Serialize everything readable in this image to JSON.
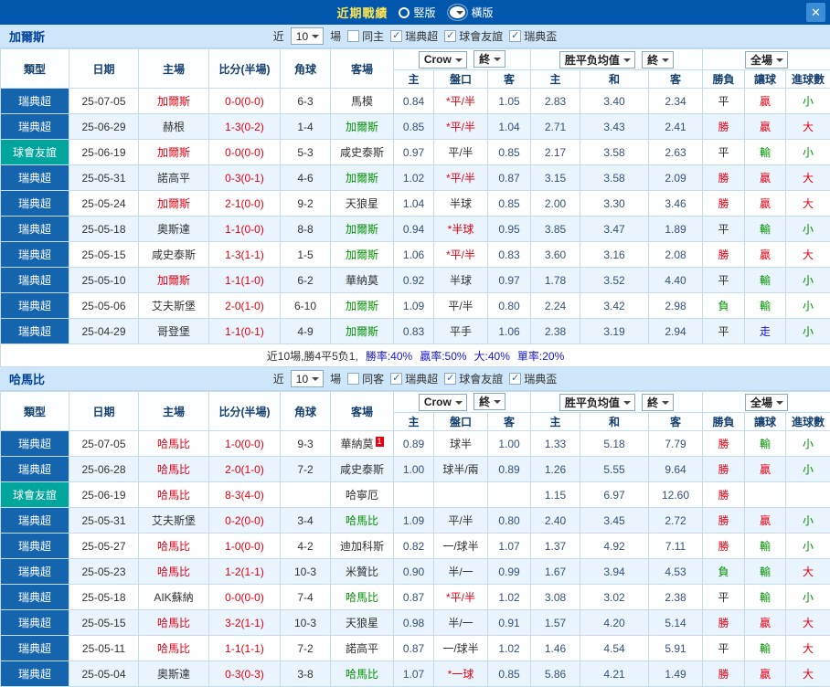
{
  "titlebar": {
    "title": "近期戰績",
    "vertical": "竪版",
    "horizontal": "橫版",
    "close": "✕"
  },
  "labels": {
    "near": "近",
    "count": "10",
    "matches": "場",
    "company": "Crow",
    "final": "終",
    "avg": "胜平负均值",
    "full": "全場",
    "filters": [
      "瑞典超",
      "球會友誼",
      "瑞典盃"
    ]
  },
  "columns": {
    "type": "類型",
    "date": "日期",
    "home": "主場",
    "score": "比分(半場)",
    "corner": "角球",
    "away": "客場",
    "h": "主",
    "handicap": "盤口",
    "a": "客",
    "avg_h": "主",
    "avg_d": "和",
    "avg_a": "客",
    "result": "勝負",
    "hresult": "讓球",
    "goals": "進球數"
  },
  "sections": [
    {
      "team": "加爾斯",
      "same_label": "同主",
      "rows": [
        {
          "league": "瑞典超",
          "lc": "lg-super",
          "date": "25-07-05",
          "home": "加爾斯",
          "home_c": "red",
          "score": "0-0(0-0)",
          "corner": "6-3",
          "away": "馬模",
          "away_c": "dark",
          "oh": "0.84",
          "hcap": "*平/半",
          "hcap_c": "red",
          "oa": "1.05",
          "ah": "2.83",
          "ad": "3.40",
          "aa": "2.34",
          "res": "平",
          "res_c": "dark",
          "hr": "贏",
          "hr_c": "red",
          "g": "小",
          "g_c": "green"
        },
        {
          "league": "瑞典超",
          "lc": "lg-super",
          "date": "25-06-29",
          "home": "赫根",
          "home_c": "dark",
          "score": "1-3(0-2)",
          "corner": "1-4",
          "away": "加爾斯",
          "away_c": "green",
          "oh": "0.85",
          "hcap": "*平/半",
          "hcap_c": "red",
          "oa": "1.04",
          "ah": "2.71",
          "ad": "3.43",
          "aa": "2.41",
          "res": "勝",
          "res_c": "red",
          "hr": "贏",
          "hr_c": "red",
          "g": "大",
          "g_c": "red"
        },
        {
          "league": "球會友誼",
          "lc": "lg-friendly",
          "date": "25-06-19",
          "home": "加爾斯",
          "home_c": "red",
          "score": "0-0(0-0)",
          "corner": "5-3",
          "away": "咸史泰斯",
          "away_c": "dark",
          "oh": "0.97",
          "hcap": "平/半",
          "hcap_c": "dark",
          "oa": "0.85",
          "ah": "2.17",
          "ad": "3.58",
          "aa": "2.63",
          "res": "平",
          "res_c": "dark",
          "hr": "輸",
          "hr_c": "green",
          "g": "小",
          "g_c": "green"
        },
        {
          "league": "瑞典超",
          "lc": "lg-super",
          "date": "25-05-31",
          "home": "諾高平",
          "home_c": "dark",
          "score": "0-3(0-1)",
          "corner": "4-6",
          "away": "加爾斯",
          "away_c": "green",
          "oh": "1.02",
          "hcap": "*平/半",
          "hcap_c": "red",
          "oa": "0.87",
          "ah": "3.15",
          "ad": "3.58",
          "aa": "2.09",
          "res": "勝",
          "res_c": "red",
          "hr": "贏",
          "hr_c": "red",
          "g": "大",
          "g_c": "red"
        },
        {
          "league": "瑞典超",
          "lc": "lg-super",
          "date": "25-05-24",
          "home": "加爾斯",
          "home_c": "red",
          "score": "2-1(0-0)",
          "corner": "9-2",
          "away": "天狼星",
          "away_c": "dark",
          "oh": "1.04",
          "hcap": "半球",
          "hcap_c": "dark",
          "oa": "0.85",
          "ah": "2.00",
          "ad": "3.30",
          "aa": "3.46",
          "res": "勝",
          "res_c": "red",
          "hr": "贏",
          "hr_c": "red",
          "g": "大",
          "g_c": "red"
        },
        {
          "league": "瑞典超",
          "lc": "lg-super",
          "date": "25-05-18",
          "home": "奧斯達",
          "home_c": "dark",
          "score": "1-1(0-0)",
          "corner": "8-8",
          "away": "加爾斯",
          "away_c": "green",
          "oh": "0.94",
          "hcap": "*半球",
          "hcap_c": "red",
          "oa": "0.95",
          "ah": "3.85",
          "ad": "3.47",
          "aa": "1.89",
          "res": "平",
          "res_c": "dark",
          "hr": "輸",
          "hr_c": "green",
          "g": "小",
          "g_c": "green"
        },
        {
          "league": "瑞典超",
          "lc": "lg-super",
          "date": "25-05-15",
          "home": "咸史泰斯",
          "home_c": "dark",
          "score": "1-3(1-1)",
          "corner": "1-5",
          "away": "加爾斯",
          "away_c": "green",
          "oh": "1.06",
          "hcap": "*平/半",
          "hcap_c": "red",
          "oa": "0.83",
          "ah": "3.60",
          "ad": "3.16",
          "aa": "2.08",
          "res": "勝",
          "res_c": "red",
          "hr": "贏",
          "hr_c": "red",
          "g": "大",
          "g_c": "red"
        },
        {
          "league": "瑞典超",
          "lc": "lg-super",
          "date": "25-05-10",
          "home": "加爾斯",
          "home_c": "red",
          "score": "1-1(1-0)",
          "corner": "6-2",
          "away": "華納莫",
          "away_c": "dark",
          "oh": "0.92",
          "hcap": "半球",
          "hcap_c": "dark",
          "oa": "0.97",
          "ah": "1.78",
          "ad": "3.52",
          "aa": "4.40",
          "res": "平",
          "res_c": "dark",
          "hr": "輸",
          "hr_c": "green",
          "g": "小",
          "g_c": "green"
        },
        {
          "league": "瑞典超",
          "lc": "lg-super",
          "date": "25-05-06",
          "home": "艾夫斯堡",
          "home_c": "dark",
          "score": "2-0(1-0)",
          "corner": "6-10",
          "away": "加爾斯",
          "away_c": "green",
          "oh": "1.09",
          "hcap": "平/半",
          "hcap_c": "dark",
          "oa": "0.80",
          "ah": "2.24",
          "ad": "3.42",
          "aa": "2.98",
          "res": "負",
          "res_c": "green",
          "hr": "輸",
          "hr_c": "green",
          "g": "小",
          "g_c": "green"
        },
        {
          "league": "瑞典超",
          "lc": "lg-super",
          "date": "25-04-29",
          "home": "哥登堡",
          "home_c": "dark",
          "score": "1-1(0-1)",
          "corner": "4-9",
          "away": "加爾斯",
          "away_c": "green",
          "oh": "0.83",
          "hcap": "平手",
          "hcap_c": "dark",
          "oa": "1.06",
          "ah": "2.38",
          "ad": "3.19",
          "aa": "2.94",
          "res": "平",
          "res_c": "dark",
          "hr": "走",
          "hr_c": "blue",
          "g": "小",
          "g_c": "green"
        }
      ],
      "summary": [
        {
          "t": "近10場,勝4平5负1,",
          "c": "dark"
        },
        {
          "t": "勝率:40%",
          "c": "blue"
        },
        {
          "t": "贏率:50%",
          "c": "blue"
        },
        {
          "t": "大:40%",
          "c": "blue"
        },
        {
          "t": "單率:20%",
          "c": "blue"
        }
      ]
    },
    {
      "team": "哈馬比",
      "same_label": "同客",
      "rows": [
        {
          "league": "瑞典超",
          "lc": "lg-super",
          "date": "25-07-05",
          "home": "哈馬比",
          "home_c": "red",
          "score": "1-0(0-0)",
          "corner": "9-3",
          "away": "華納莫",
          "away_c": "dark",
          "badge": "1",
          "oh": "0.89",
          "hcap": "球半",
          "hcap_c": "dark",
          "oa": "1.00",
          "ah": "1.33",
          "ad": "5.18",
          "aa": "7.79",
          "res": "勝",
          "res_c": "red",
          "hr": "輸",
          "hr_c": "green",
          "g": "小",
          "g_c": "green"
        },
        {
          "league": "瑞典超",
          "lc": "lg-super",
          "date": "25-06-28",
          "home": "哈馬比",
          "home_c": "red",
          "score": "2-0(1-0)",
          "corner": "7-2",
          "away": "咸史泰斯",
          "away_c": "dark",
          "oh": "1.00",
          "hcap": "球半/兩",
          "hcap_c": "dark",
          "oa": "0.89",
          "ah": "1.26",
          "ad": "5.55",
          "aa": "9.64",
          "res": "勝",
          "res_c": "red",
          "hr": "贏",
          "hr_c": "red",
          "g": "小",
          "g_c": "green"
        },
        {
          "league": "球會友誼",
          "lc": "lg-friendly",
          "date": "25-06-19",
          "home": "哈馬比",
          "home_c": "red",
          "score": "8-3(4-0)",
          "corner": "",
          "away": "哈寧厄",
          "away_c": "dark",
          "oh": "",
          "hcap": "",
          "hcap_c": "dark",
          "oa": "",
          "ah": "1.15",
          "ad": "6.97",
          "aa": "12.60",
          "res": "勝",
          "res_c": "red",
          "hr": "",
          "hr_c": "dark",
          "g": "",
          "g_c": "dark"
        },
        {
          "league": "瑞典超",
          "lc": "lg-super",
          "date": "25-05-31",
          "home": "艾夫斯堡",
          "home_c": "dark",
          "score": "0-2(0-0)",
          "corner": "3-4",
          "away": "哈馬比",
          "away_c": "green",
          "oh": "1.09",
          "hcap": "平/半",
          "hcap_c": "dark",
          "oa": "0.80",
          "ah": "2.40",
          "ad": "3.45",
          "aa": "2.72",
          "res": "勝",
          "res_c": "red",
          "hr": "贏",
          "hr_c": "red",
          "g": "小",
          "g_c": "green"
        },
        {
          "league": "瑞典超",
          "lc": "lg-super",
          "date": "25-05-27",
          "home": "哈馬比",
          "home_c": "red",
          "score": "1-0(0-0)",
          "corner": "4-2",
          "away": "迪加科斯",
          "away_c": "dark",
          "oh": "0.82",
          "hcap": "一/球半",
          "hcap_c": "dark",
          "oa": "1.07",
          "ah": "1.37",
          "ad": "4.92",
          "aa": "7.11",
          "res": "勝",
          "res_c": "red",
          "hr": "輸",
          "hr_c": "green",
          "g": "小",
          "g_c": "green"
        },
        {
          "league": "瑞典超",
          "lc": "lg-super",
          "date": "25-05-23",
          "home": "哈馬比",
          "home_c": "red",
          "score": "1-2(1-1)",
          "corner": "10-3",
          "away": "米贊比",
          "away_c": "dark",
          "oh": "0.90",
          "hcap": "半/一",
          "hcap_c": "dark",
          "oa": "0.99",
          "ah": "1.67",
          "ad": "3.94",
          "aa": "4.53",
          "res": "負",
          "res_c": "green",
          "hr": "輸",
          "hr_c": "green",
          "g": "大",
          "g_c": "red"
        },
        {
          "league": "瑞典超",
          "lc": "lg-super",
          "date": "25-05-18",
          "home": "AIK蘇納",
          "home_c": "dark",
          "score": "0-0(0-0)",
          "corner": "7-4",
          "away": "哈馬比",
          "away_c": "green",
          "oh": "0.87",
          "hcap": "*平/半",
          "hcap_c": "red",
          "oa": "1.02",
          "ah": "3.08",
          "ad": "3.02",
          "aa": "2.38",
          "res": "平",
          "res_c": "dark",
          "hr": "輸",
          "hr_c": "green",
          "g": "小",
          "g_c": "green"
        },
        {
          "league": "瑞典超",
          "lc": "lg-super",
          "date": "25-05-15",
          "home": "哈馬比",
          "home_c": "red",
          "score": "3-2(1-1)",
          "corner": "10-3",
          "away": "天狼星",
          "away_c": "dark",
          "oh": "0.98",
          "hcap": "半/一",
          "hcap_c": "dark",
          "oa": "0.91",
          "ah": "1.57",
          "ad": "4.20",
          "aa": "5.14",
          "res": "勝",
          "res_c": "red",
          "hr": "贏",
          "hr_c": "red",
          "g": "大",
          "g_c": "red"
        },
        {
          "league": "瑞典超",
          "lc": "lg-super",
          "date": "25-05-11",
          "home": "哈馬比",
          "home_c": "red",
          "score": "1-1(1-1)",
          "corner": "7-2",
          "away": "諾高平",
          "away_c": "dark",
          "oh": "0.87",
          "hcap": "一/球半",
          "hcap_c": "dark",
          "oa": "1.02",
          "ah": "1.46",
          "ad": "4.54",
          "aa": "5.91",
          "res": "平",
          "res_c": "dark",
          "hr": "輸",
          "hr_c": "green",
          "g": "大",
          "g_c": "red"
        },
        {
          "league": "瑞典超",
          "lc": "lg-super",
          "date": "25-05-04",
          "home": "奧斯達",
          "home_c": "dark",
          "score": "0-3(0-3)",
          "corner": "3-8",
          "away": "哈馬比",
          "away_c": "green",
          "oh": "1.07",
          "hcap": "*一球",
          "hcap_c": "red",
          "oa": "0.85",
          "ah": "5.86",
          "ad": "4.21",
          "aa": "1.49",
          "res": "勝",
          "res_c": "red",
          "hr": "贏",
          "hr_c": "red",
          "g": "大",
          "g_c": "red"
        }
      ]
    }
  ]
}
